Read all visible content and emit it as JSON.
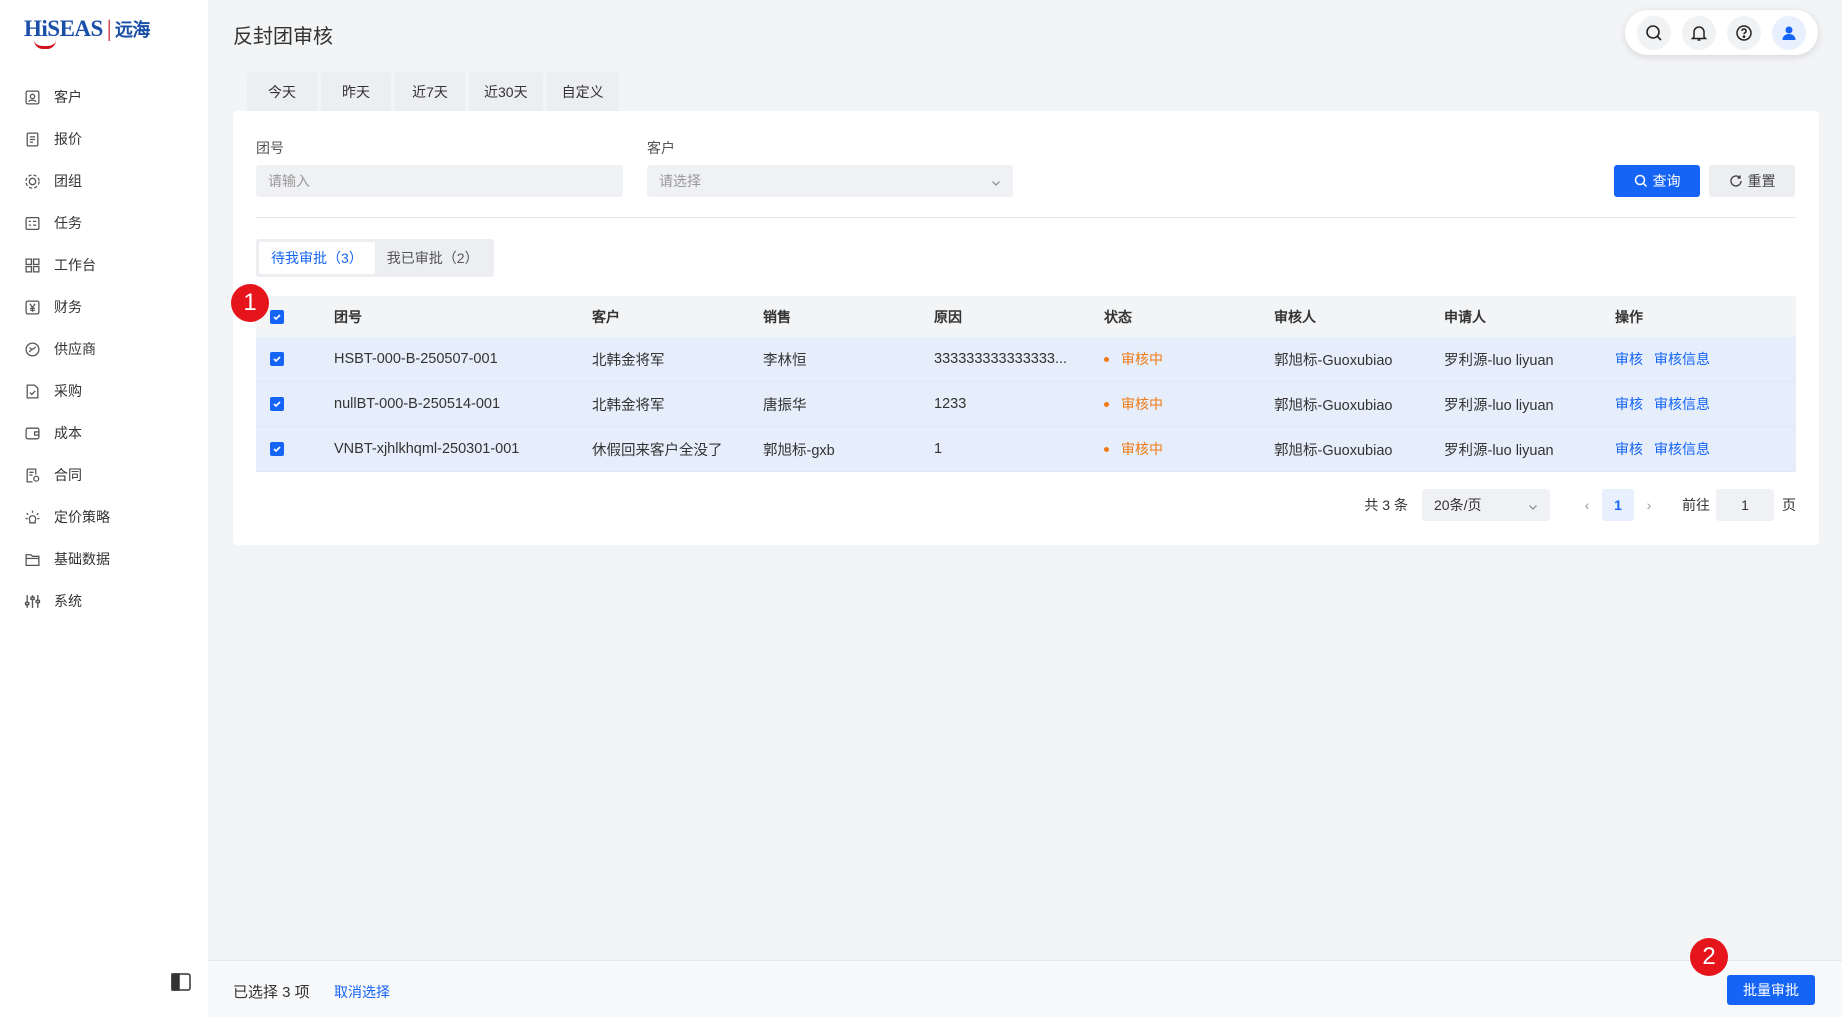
{
  "app": {
    "logo_text": "HiSEAS",
    "logo_cn": "远海",
    "page_title": "反封团审核"
  },
  "sidebar": {
    "items": [
      {
        "label": "客户",
        "icon": "customer-icon"
      },
      {
        "label": "报价",
        "icon": "quote-icon"
      },
      {
        "label": "团组",
        "icon": "group-icon"
      },
      {
        "label": "任务",
        "icon": "task-icon"
      },
      {
        "label": "工作台",
        "icon": "workbench-icon"
      },
      {
        "label": "财务",
        "icon": "finance-icon"
      },
      {
        "label": "供应商",
        "icon": "supplier-icon"
      },
      {
        "label": "采购",
        "icon": "purchase-icon"
      },
      {
        "label": "成本",
        "icon": "cost-icon"
      },
      {
        "label": "合同",
        "icon": "contract-icon"
      },
      {
        "label": "定价策略",
        "icon": "pricing-icon"
      },
      {
        "label": "基础数据",
        "icon": "basic-data-icon"
      },
      {
        "label": "系统",
        "icon": "system-icon"
      }
    ]
  },
  "header_tools": [
    "search-icon",
    "bell-icon",
    "help-icon",
    "user-icon"
  ],
  "date_tabs": [
    "今天",
    "昨天",
    "近7天",
    "近30天",
    "自定义"
  ],
  "filters": {
    "group_no_label": "团号",
    "group_no_placeholder": "请输入",
    "customer_label": "客户",
    "customer_placeholder": "请选择",
    "query_label": "查询",
    "reset_label": "重置"
  },
  "segments": {
    "pending": "待我审批（3）",
    "done": "我已审批（2）"
  },
  "table": {
    "headers": [
      "团号",
      "客户",
      "销售",
      "原因",
      "状态",
      "审核人",
      "申请人",
      "操作"
    ],
    "rows": [
      {
        "group_no": "HSBT-000-B-250507-001",
        "customer": "北韩金将军",
        "sales": "李林恒",
        "reason": "333333333333333...",
        "status": "审核中",
        "reviewer": "郭旭标-Guoxubiao",
        "applicant": "罗利源-luo liyuan",
        "action1": "审核",
        "action2": "审核信息"
      },
      {
        "group_no": "nullBT-000-B-250514-001",
        "customer": "北韩金将军",
        "sales": "唐振华",
        "reason": "1233",
        "status": "审核中",
        "reviewer": "郭旭标-Guoxubiao",
        "applicant": "罗利源-luo liyuan",
        "action1": "审核",
        "action2": "审核信息"
      },
      {
        "group_no": "VNBT-xjhlkhqml-250301-001",
        "customer": "休假回来客户全没了",
        "sales": "郭旭标-gxb",
        "reason": "1",
        "status": "审核中",
        "reviewer": "郭旭标-Guoxubiao",
        "applicant": "罗利源-luo liyuan",
        "action1": "审核",
        "action2": "审核信息"
      }
    ]
  },
  "pagination": {
    "total": "共 3 条",
    "page_size": "20条/页",
    "current_page": "1",
    "goto_label": "前往",
    "goto_value": "1",
    "page_unit": "页"
  },
  "footer": {
    "selected": "已选择 3 项",
    "cancel": "取消选择",
    "batch": "批量审批"
  },
  "markers": [
    "1",
    "2"
  ],
  "colors": {
    "primary": "#1564f5",
    "status_pending": "#f07b14",
    "marker": "#e6141b",
    "row_selected": "#e6eefc"
  }
}
